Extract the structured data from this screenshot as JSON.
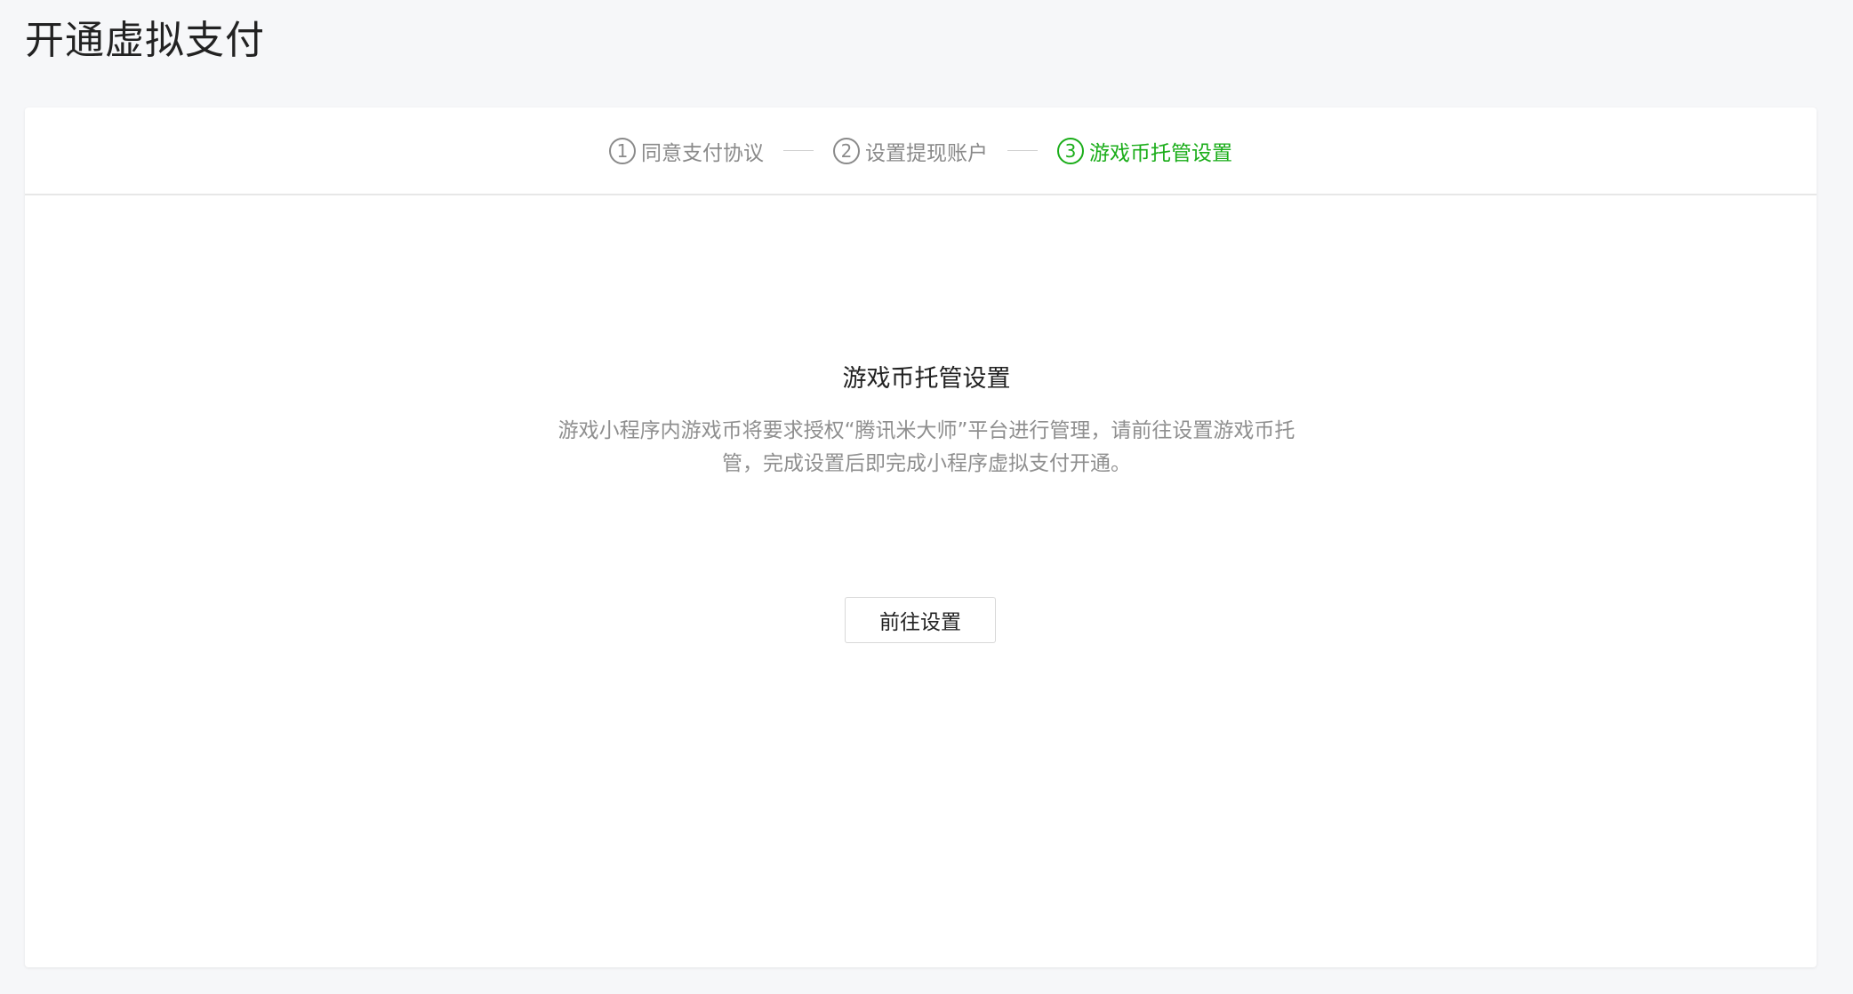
{
  "page": {
    "title": "开通虚拟支付"
  },
  "steps": [
    {
      "num": "1",
      "label": "同意支付协议",
      "state": "done"
    },
    {
      "num": "2",
      "label": "设置提现账户",
      "state": "done"
    },
    {
      "num": "3",
      "label": "游戏币托管设置",
      "state": "active"
    }
  ],
  "main": {
    "heading": "游戏币托管设置",
    "description": "游戏小程序内游戏币将要求授权“腾讯米大师”平台进行管理，请前往设置游戏币托管，完成设置后即完成小程序虚拟支付开通。",
    "button_label": "前往设置"
  },
  "colors": {
    "accent": "#1aad19",
    "muted": "#8a8a8a",
    "background": "#f6f7f9"
  }
}
